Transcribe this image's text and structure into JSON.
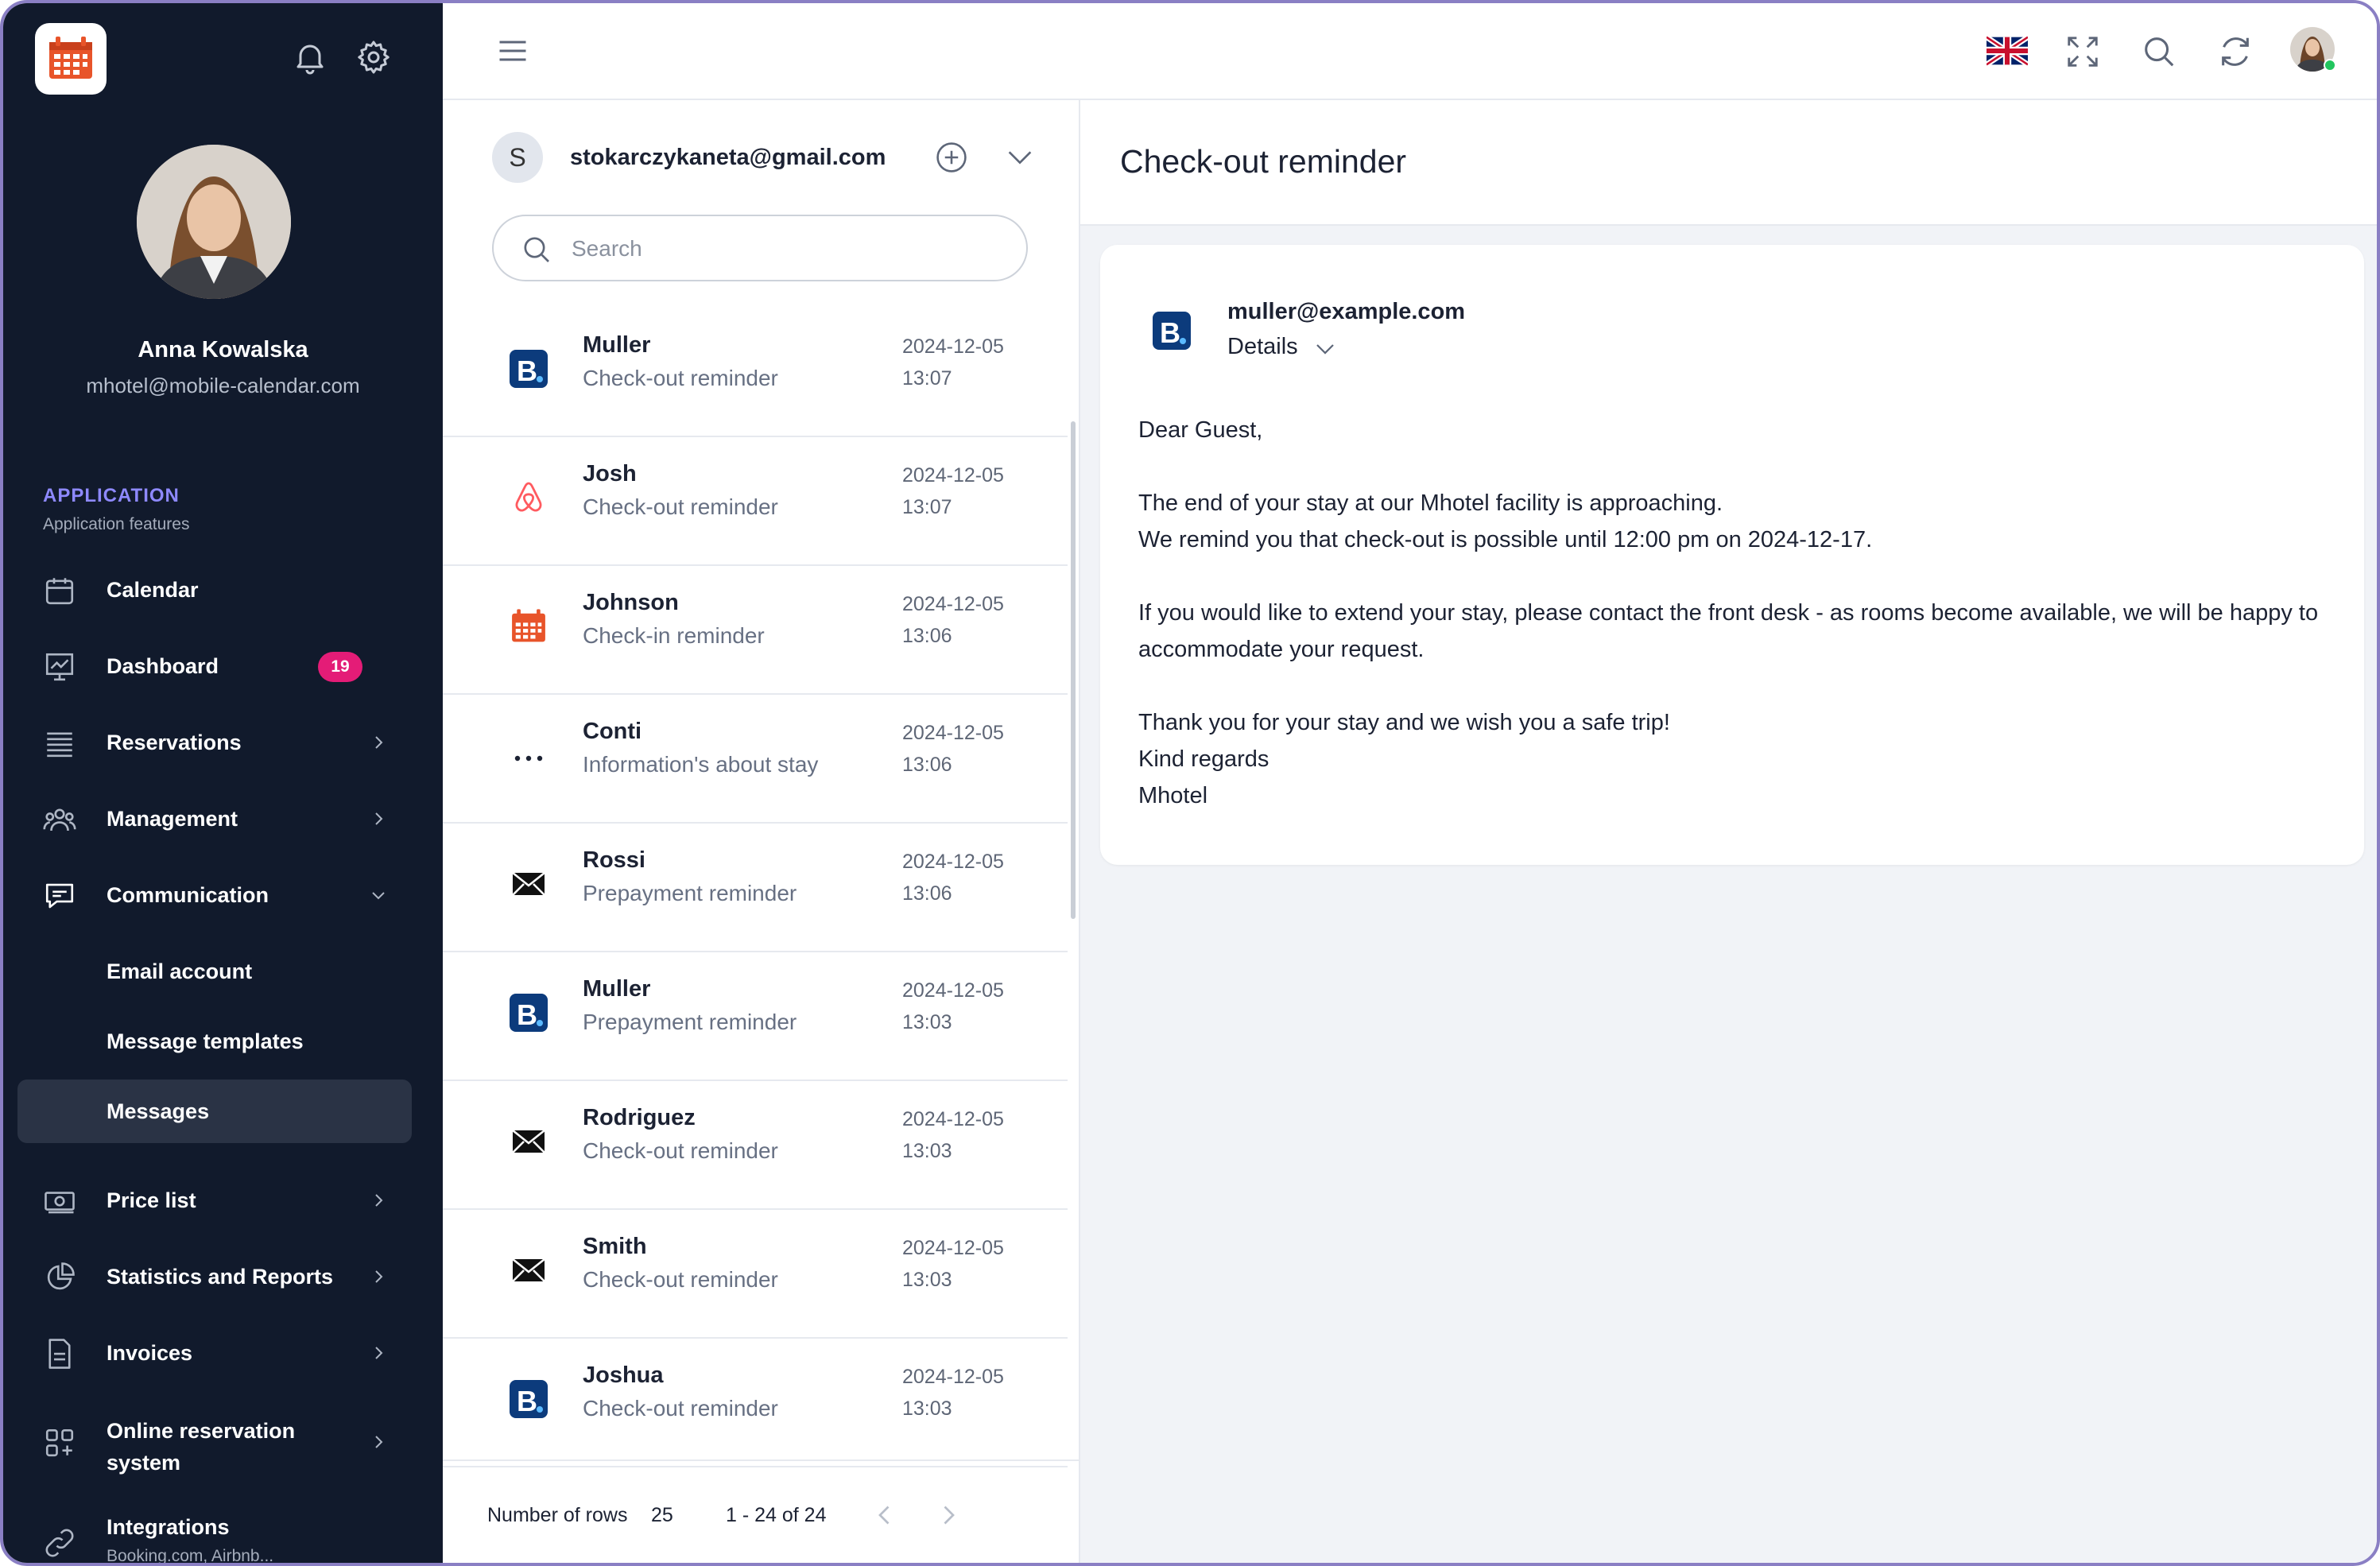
{
  "sidebar": {
    "user": {
      "name": "Anna Kowalska",
      "email": "mhotel@mobile-calendar.com"
    },
    "section": {
      "title": "APPLICATION",
      "subtitle": "Application features"
    },
    "nav": {
      "calendar": "Calendar",
      "dashboard": "Dashboard",
      "dashboard_badge": "19",
      "reservations": "Reservations",
      "management": "Management",
      "communication": "Communication",
      "email_account": "Email account",
      "message_templates": "Message templates",
      "messages": "Messages",
      "price_list": "Price list",
      "statistics": "Statistics and Reports",
      "invoices": "Invoices",
      "online_reservation": "Online reservation system",
      "integrations": "Integrations",
      "integrations_sub": "Booking.com, Airbnb..."
    }
  },
  "account": {
    "initial": "S",
    "email": "stokarczykaneta@gmail.com"
  },
  "search": {
    "placeholder": "Search"
  },
  "messages": [
    {
      "source": "booking",
      "name": "Muller",
      "subject": "Check-out reminder",
      "date": "2024-12-05",
      "time": "13:07"
    },
    {
      "source": "airbnb",
      "name": "Josh",
      "subject": "Check-out reminder",
      "date": "2024-12-05",
      "time": "13:07"
    },
    {
      "source": "calendar",
      "name": "Johnson",
      "subject": "Check-in reminder",
      "date": "2024-12-05",
      "time": "13:06"
    },
    {
      "source": "other",
      "name": "Conti",
      "subject": "Information's about stay",
      "date": "2024-12-05",
      "time": "13:06"
    },
    {
      "source": "email",
      "name": "Rossi",
      "subject": "Prepayment reminder",
      "date": "2024-12-05",
      "time": "13:06"
    },
    {
      "source": "booking",
      "name": "Muller",
      "subject": "Prepayment reminder",
      "date": "2024-12-05",
      "time": "13:03"
    },
    {
      "source": "email",
      "name": "Rodriguez",
      "subject": "Check-out reminder",
      "date": "2024-12-05",
      "time": "13:03"
    },
    {
      "source": "email",
      "name": "Smith",
      "subject": "Check-out reminder",
      "date": "2024-12-05",
      "time": "13:03"
    },
    {
      "source": "booking",
      "name": "Joshua",
      "subject": "Check-out reminder",
      "date": "2024-12-05",
      "time": "13:03"
    }
  ],
  "pager": {
    "rows_label": "Number of rows",
    "rows_value": "25",
    "range": "1 - 24 of 24"
  },
  "detail": {
    "title": "Check-out reminder",
    "from": "muller@example.com",
    "details_label": "Details",
    "body": [
      "Dear Guest,",
      "",
      "The end of your stay at our Mhotel facility is approaching.",
      "We remind you that check-out is possible until 12:00 pm on 2024-12-17.",
      "",
      "If you would like to extend your stay, please contact the front desk - as rooms become available, we will be happy to accommodate your request.",
      "",
      "Thank you for your stay and we wish you a safe trip!",
      "Kind regards",
      "Mhotel"
    ]
  },
  "colors": {
    "sidebar_bg": "#111a2c",
    "accent": "#8e89ff",
    "badge": "#e41c77",
    "booking_blue": "#0c3b7c",
    "airbnb": "#ff5a5f",
    "calendar_orange": "#e8542a"
  }
}
